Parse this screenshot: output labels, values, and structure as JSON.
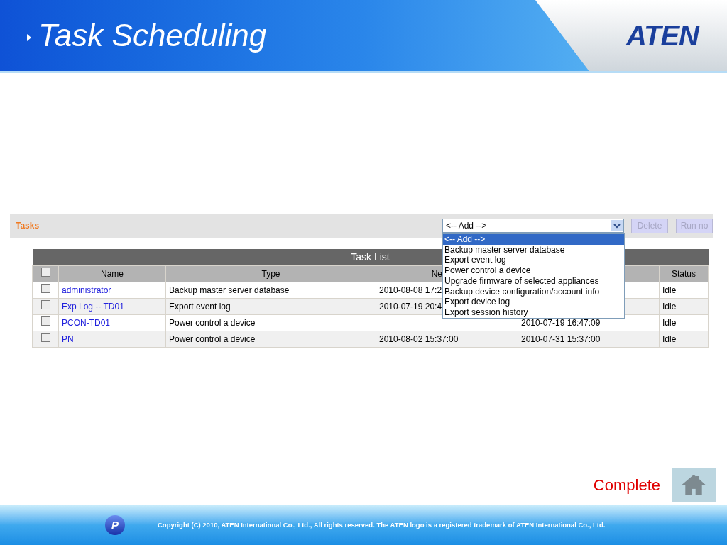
{
  "slide": {
    "title": "Task Scheduling",
    "logo": "ATEN"
  },
  "toolbar": {
    "title": "Tasks",
    "select": {
      "value": "<-- Add -->",
      "expanded": true,
      "options": [
        {
          "label": "<-- Add -->",
          "selected": true
        },
        {
          "label": "Backup master server database",
          "selected": false
        },
        {
          "label": "Export event log",
          "selected": false
        },
        {
          "label": "Power control a device",
          "selected": false
        },
        {
          "label": "Upgrade firmware of selected appliances",
          "selected": false
        },
        {
          "label": "Backup device configuration/account info",
          "selected": false
        },
        {
          "label": "Export device log",
          "selected": false
        },
        {
          "label": "Export session history",
          "selected": false
        }
      ]
    },
    "buttons": [
      {
        "label": "Delete",
        "disabled": true
      },
      {
        "label": "Run no",
        "disabled": true
      }
    ]
  },
  "table": {
    "title": "Task List",
    "all_checked": false,
    "columns": {
      "name": "Name",
      "type": "Type",
      "column_3": "Ne",
      "status": "Status"
    },
    "rows": [
      {
        "checked": false,
        "name": "administrator",
        "type": "Backup master server database",
        "column_3": "2010-08-08 17:2",
        "status": "Idle"
      },
      {
        "checked": false,
        "name": "Exp Log -- TD01",
        "type": "Export event log",
        "column_3": "2010-07-19 20:4",
        "status": "Idle"
      },
      {
        "checked": false,
        "name": "PCON-TD01",
        "type": "Power control a device",
        "column_4": "2010-07-19 16:47:09",
        "status": "Idle"
      },
      {
        "checked": false,
        "name": "PN",
        "type": "Power control a device",
        "column_3": "2010-08-02 15:37:00",
        "column_4": "2010-07-31 15:37:00",
        "status": "Idle"
      }
    ]
  },
  "complete_label": "Complete",
  "footer": {
    "logo_letter": "P",
    "copyright": "Copyright (C) 2010, ATEN International Co., Ltd., All rights reserved. The ATEN logo is a registered trademark of ATEN International Co., Ltd."
  }
}
